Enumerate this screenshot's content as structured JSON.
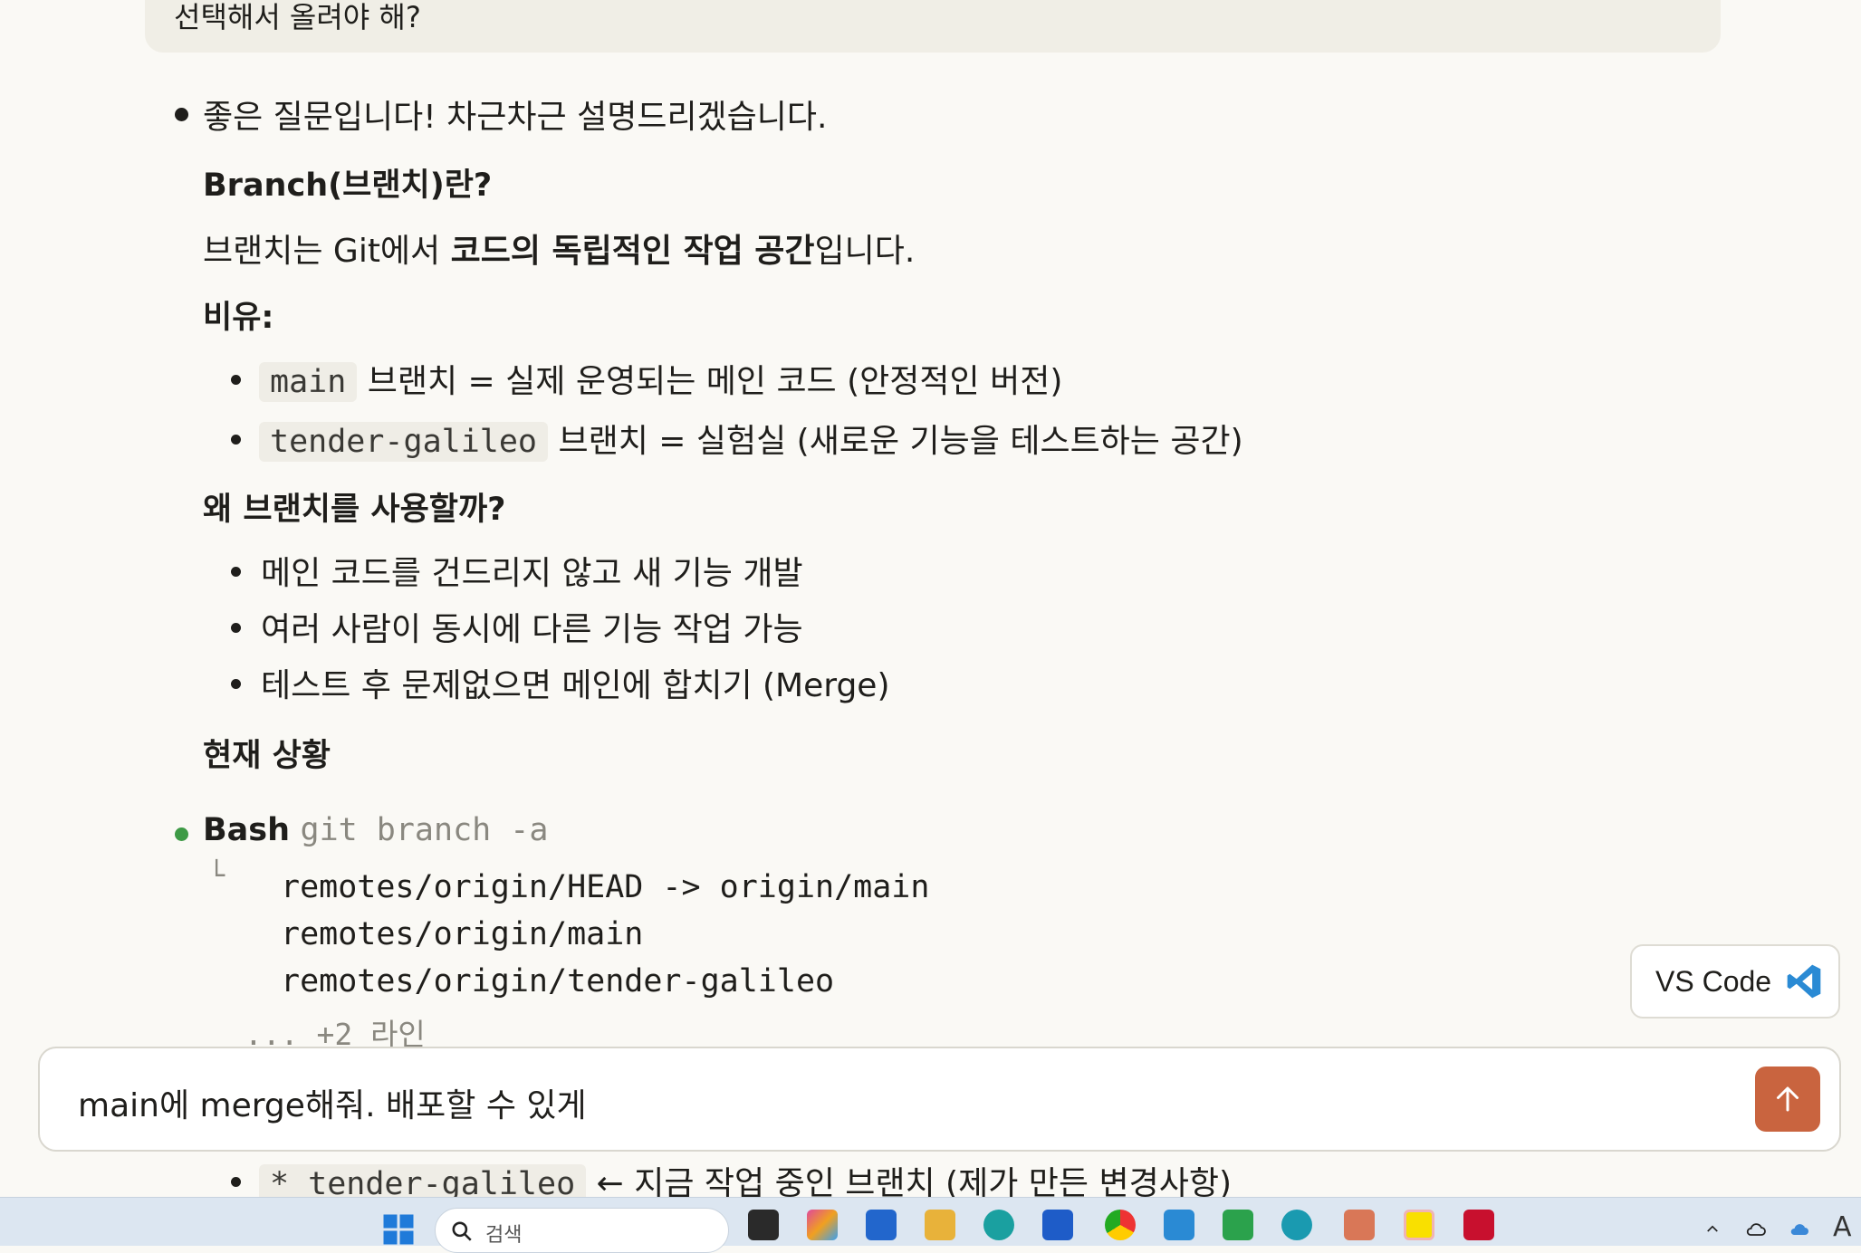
{
  "previous_message": "선택해서 올려야 해?",
  "reply": {
    "intro": "좋은 질문입니다! 차근차근 설명드리겠습니다.",
    "h_branch": "Branch(브랜치)란?",
    "def_pre": "브랜치는 Git에서 ",
    "def_bold": "코드의 독립적인 작업 공간",
    "def_post": "입니다.",
    "h_analogy": "비유:",
    "analogy": [
      {
        "code": "main",
        "text": " 브랜치 = 실제 운영되는 메인 코드 (안정적인 버전)"
      },
      {
        "code": "tender-galileo",
        "text": " 브랜치 = 실험실 (새로운 기능을 테스트하는 공간)"
      }
    ],
    "h_why": "왜 브랜치를 사용할까?",
    "why": [
      "메인 코드를 건드리지 않고 새 기능 개발",
      "여러 사람이 동시에 다른 기능 작업 가능",
      "테스트 후 문제없으면 메인에 합치기 (Merge)"
    ],
    "h_status": "현재 상황"
  },
  "bash": {
    "label": "Bash",
    "command": "git branch -a",
    "tree_char": "└",
    "output": [
      "remotes/origin/HEAD -> origin/main",
      "remotes/origin/main",
      "remotes/origin/tender-galileo"
    ],
    "more": "... +2 라인"
  },
  "partial_bullet": {
    "code": "* tender-galileo",
    "text": " ← 지금 작업 중인 브랜치 (제가 만든 변경사항)"
  },
  "vscode_button": {
    "label": "VS Code"
  },
  "input": {
    "value": "main에 merge해줘. 배포할 수 있게"
  },
  "taskbar": {
    "search_placeholder": "검색",
    "lang": "A"
  },
  "colors": {
    "accent_send": "#c9643f",
    "bullet_green": "#3d9a45",
    "vscode_blue": "#2a8ad4"
  }
}
